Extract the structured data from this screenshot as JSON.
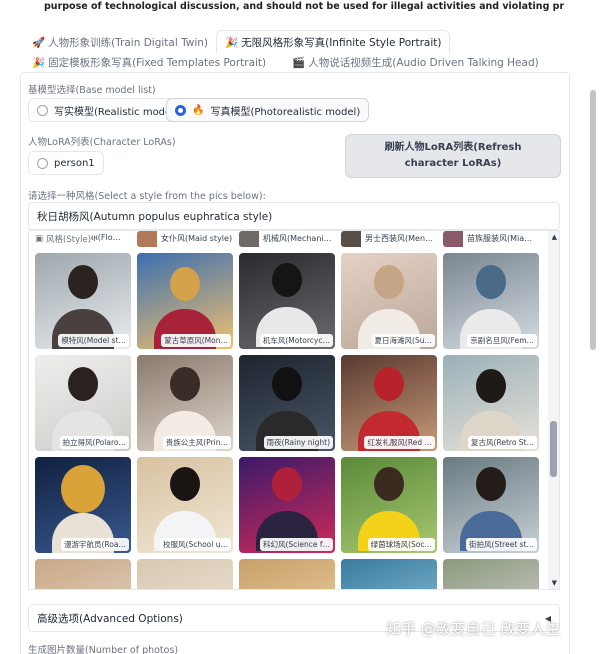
{
  "notice": "purpose of technological discussion, and should not be used for illegal activities and violating privacy of individuals.)",
  "tabs": [
    {
      "icon": "🚀",
      "label": "人物形象训练(Train Digital Twin)",
      "active": false
    },
    {
      "icon": "🎉",
      "label": "无限风格形象写真(Infinite Style Portrait)",
      "active": true
    },
    {
      "icon": "🎉",
      "label": "固定模板形象写真(Fixed Templates Portrait)",
      "active": false
    },
    {
      "icon": "🎬",
      "label": "人物说话视频生成(Audio Driven Talking Head)",
      "active": false
    }
  ],
  "base_model": {
    "label": "基模型选择(Base model list)",
    "options": [
      {
        "label": "写实模型(Realistic model)",
        "selected": false
      },
      {
        "label": "写真模型(Photorealistic model)",
        "selected": true,
        "icon": "🔥"
      }
    ]
  },
  "lora": {
    "label": "人物LoRA列表(Character LoRAs)",
    "options": [
      {
        "label": "person1",
        "selected": false
      }
    ],
    "refresh_button": "刷新人物LoRA列表(Refresh character LoRAs)"
  },
  "style": {
    "label": "请选择一种风格(Select a style from the pics below):",
    "selected_value": "秋日胡杨风(Autumn populus euphratica style)",
    "gallery_label": "风格(Style)",
    "header_row": [
      "𐍂𐍂(Flo…",
      "女仆风(Maid style)",
      "机械风(Mechani…",
      "男士西装风(Men…",
      "苗族服装风(Mia…"
    ],
    "rows": [
      [
        "模特风(Model st…",
        "蒙古草原风(Mon…",
        "机车风(Motorcyc…",
        "夏日海滩风(Su…",
        "京剧名旦风(Fem…"
      ],
      [
        "拍立得风(Polaro…",
        "贵族公主风(Prin…",
        "雨夜(Rainy night)",
        "红发礼服风(Red …",
        "复古风(Retro St…"
      ],
      [
        "漫游宇航员(Roa…",
        "校服风(School u…",
        "科幻风(Science f…",
        "绿茵球场风(Soc…",
        "街拍风(Street st…"
      ],
      [
        "",
        "",
        "",
        "",
        ""
      ]
    ]
  },
  "advanced": {
    "label": "高级选项(Advanced Options)",
    "caret": "◀"
  },
  "photos_label": "生成图片数量(Number of photos)",
  "watermark": "知乎 @改变自己 改变人生",
  "colors": {
    "accent": "#2563eb",
    "fire": "#f97316",
    "border": "#e5e7eb"
  }
}
